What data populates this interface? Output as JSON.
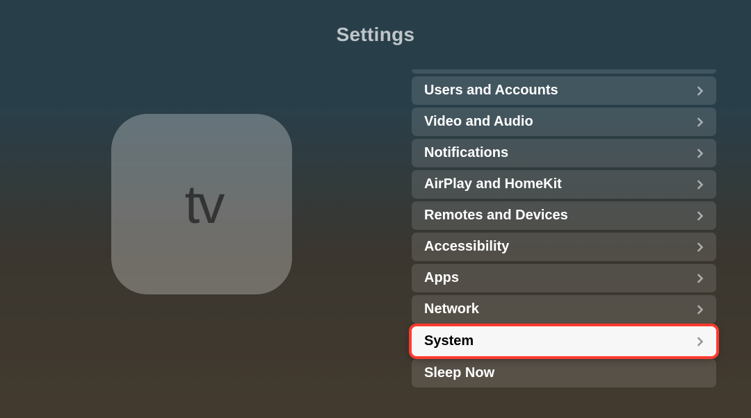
{
  "page": {
    "title": "Settings"
  },
  "tile": {
    "tv_text": "tv"
  },
  "menu": {
    "items": [
      {
        "label": "Users and Accounts",
        "chevron": true,
        "selected": false
      },
      {
        "label": "Video and Audio",
        "chevron": true,
        "selected": false
      },
      {
        "label": "Notifications",
        "chevron": true,
        "selected": false
      },
      {
        "label": "AirPlay and HomeKit",
        "chevron": true,
        "selected": false
      },
      {
        "label": "Remotes and Devices",
        "chevron": true,
        "selected": false
      },
      {
        "label": "Accessibility",
        "chevron": true,
        "selected": false
      },
      {
        "label": "Apps",
        "chevron": true,
        "selected": false
      },
      {
        "label": "Network",
        "chevron": true,
        "selected": false
      },
      {
        "label": "System",
        "chevron": true,
        "selected": true
      },
      {
        "label": "Sleep Now",
        "chevron": false,
        "selected": false
      }
    ]
  }
}
